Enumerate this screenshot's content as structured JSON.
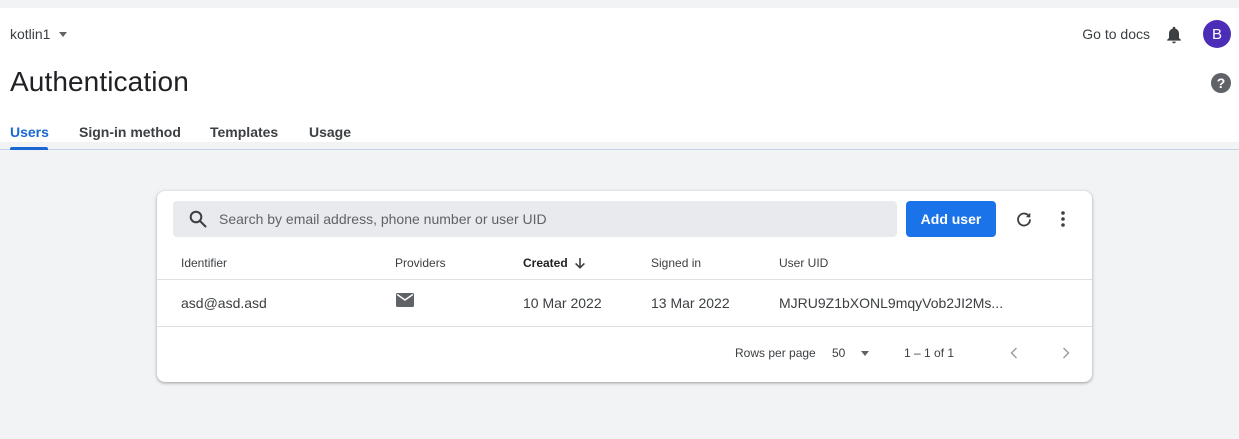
{
  "topbar": {
    "project_name": "kotlin1",
    "docs_label": "Go to docs",
    "avatar_initial": "B"
  },
  "page": {
    "title": "Authentication"
  },
  "tabs": [
    {
      "label": "Users",
      "active": true
    },
    {
      "label": "Sign-in method",
      "active": false
    },
    {
      "label": "Templates",
      "active": false
    },
    {
      "label": "Usage",
      "active": false
    }
  ],
  "users_card": {
    "search_placeholder": "Search by email address, phone number or user UID",
    "search_value": "",
    "add_user_label": "Add user",
    "columns": [
      "Identifier",
      "Providers",
      "Created",
      "Signed in",
      "User UID"
    ],
    "sorted_column": "Created",
    "rows": [
      {
        "identifier": "asd@asd.asd",
        "provider_icon": "email-icon",
        "created": "10 Mar 2022",
        "signed_in": "13 Mar 2022",
        "user_uid": "MJRU9Z1bXONL9mqyVob2JI2Ms..."
      }
    ],
    "pagination": {
      "rows_per_page_label": "Rows per page",
      "rows_per_page_value": "50",
      "range_label": "1 – 1 of 1"
    }
  },
  "colors": {
    "accent": "#1a73e8",
    "active_tab": "#1967d2",
    "avatar_bg": "#4c2db8",
    "page_bg": "#f1f3f4"
  }
}
